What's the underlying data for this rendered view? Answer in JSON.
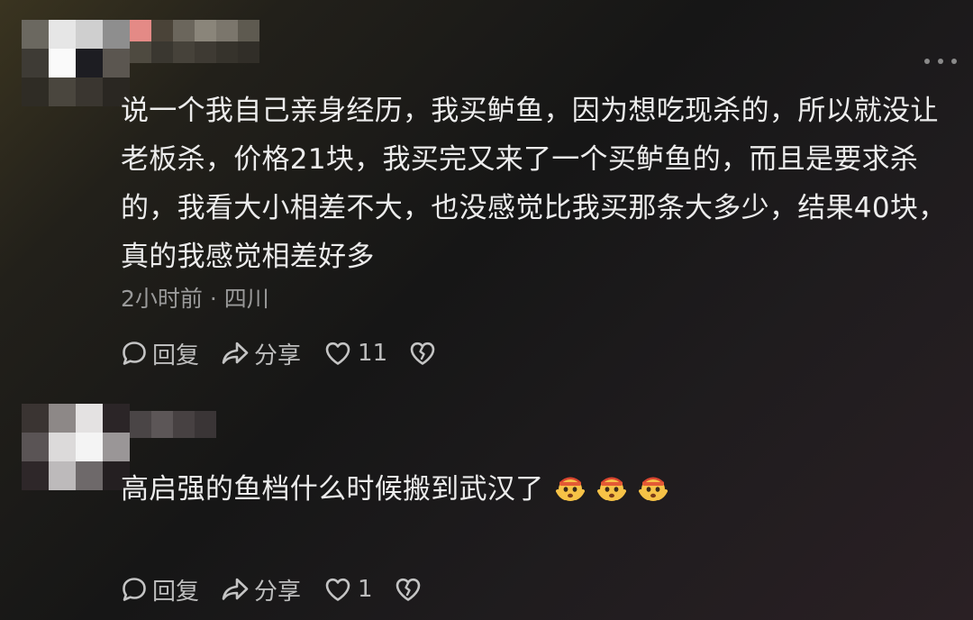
{
  "comments": [
    {
      "text": "说一个我自己亲身经历，我买鲈鱼，因为想吃现杀的，所以就没让老板杀，价格21块，我买完又来了一个买鲈鱼的，而且是要求杀的，我看大小相差不大，也没感觉比我买那条大多少，结果40块，真的我感觉相差好多",
      "meta": "2小时前 · 四川",
      "like_count": "11",
      "has_more_menu": true
    },
    {
      "text": "高启强的鱼档什么时候搬到武汉了",
      "emojis": [
        "scared-face-emoji",
        "scared-face-emoji",
        "scared-face-emoji"
      ],
      "like_count": "1"
    }
  ],
  "actions": {
    "reply_label": "回复",
    "share_label": "分享"
  },
  "icons": {
    "reply": "speech-bubble-icon",
    "share": "share-arrow-icon",
    "like": "heart-icon",
    "dislike": "broken-heart-icon",
    "more": "more-dots-icon"
  },
  "colors": {
    "text": "#ececec",
    "secondary": "#9a9a9a",
    "action": "#bdbdbd"
  }
}
